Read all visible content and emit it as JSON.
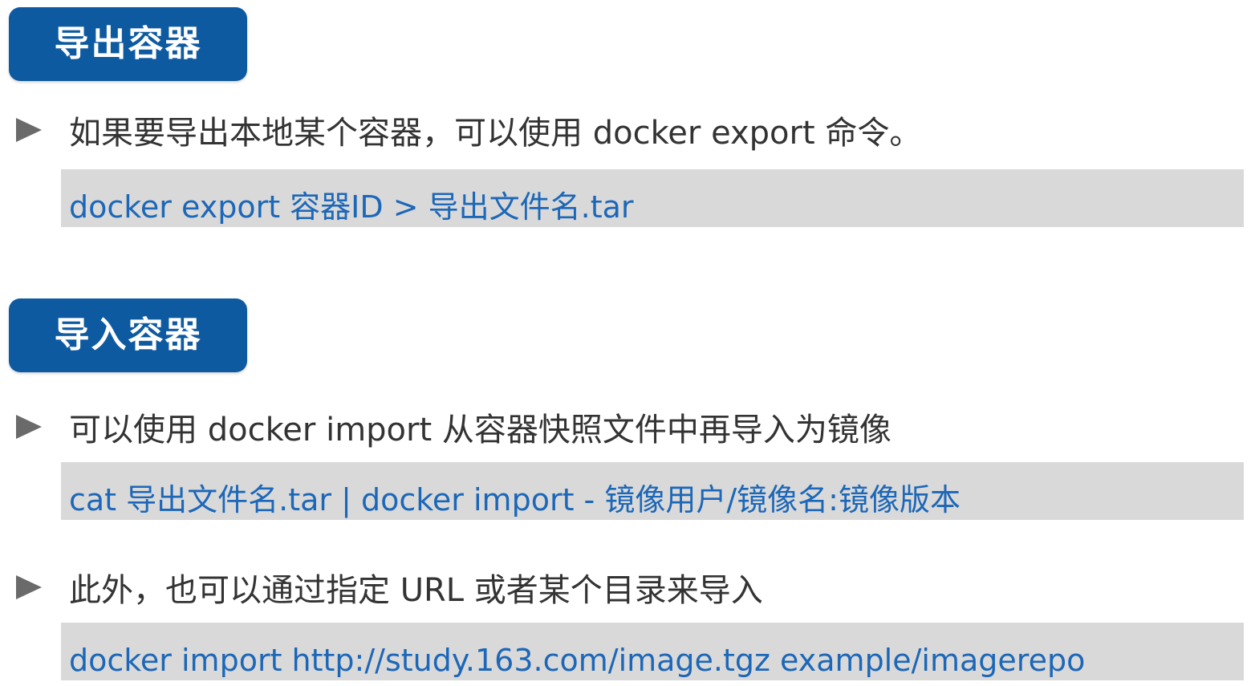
{
  "sections": [
    {
      "title": "导出容器",
      "items": [
        {
          "text": "如果要导出本地某个容器，可以使用 docker export 命令。",
          "code": "docker export 容器ID > 导出文件名.tar"
        }
      ]
    },
    {
      "title": "导入容器",
      "items": [
        {
          "text": "可以使用 docker import 从容器快照文件中再导入为镜像",
          "code": "cat 导出文件名.tar | docker import - 镜像用户/镜像名:镜像版本"
        },
        {
          "text": "此外，也可以通过指定 URL 或者某个目录来导入",
          "code": "docker import http://study.163.com/image.tgz example/imagerepo"
        }
      ]
    }
  ],
  "colors": {
    "badge": "#0e5aa0",
    "code_text": "#1c67b8",
    "code_background": "#d9d9d9",
    "body_text": "#333333",
    "bullet": "#6a6a6a"
  },
  "icons": {
    "bullet": "triangle-bullet-icon"
  }
}
